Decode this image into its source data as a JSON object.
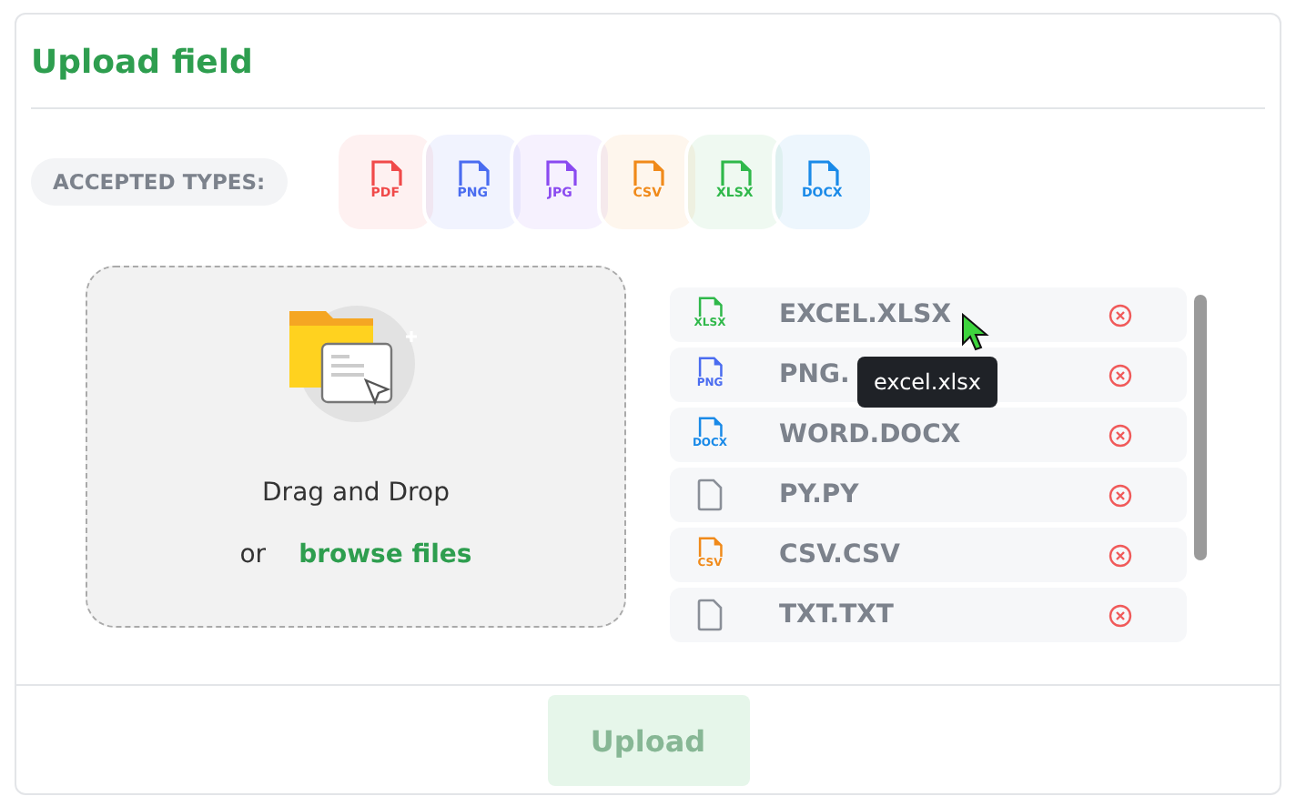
{
  "title": "Upload field",
  "accepted": {
    "label": "ACCEPTED TYPES:",
    "types": [
      {
        "label": "PDF",
        "color": "#f04a4a"
      },
      {
        "label": "PNG",
        "color": "#4a6cf0"
      },
      {
        "label": "JPG",
        "color": "#8a4af0"
      },
      {
        "label": "CSV",
        "color": "#f08a1a"
      },
      {
        "label": "XLSX",
        "color": "#2fb84a"
      },
      {
        "label": "DOCX",
        "color": "#1a8ae8"
      }
    ]
  },
  "dropzone": {
    "heading": "Drag and Drop",
    "or": "or",
    "link": "browse files"
  },
  "files": [
    {
      "name": "EXCEL.XLSX",
      "kind": "typed",
      "icon_label": "XLSX",
      "color": "#2fb84a"
    },
    {
      "name": "PNG.",
      "kind": "typed",
      "icon_label": "PNG",
      "color": "#4a6cf0"
    },
    {
      "name": "WORD.DOCX",
      "kind": "typed",
      "icon_label": "DOCX",
      "color": "#1a8ae8"
    },
    {
      "name": "PY.PY",
      "kind": "plain"
    },
    {
      "name": "CSV.CSV",
      "kind": "typed",
      "icon_label": "CSV",
      "color": "#f08a1a"
    },
    {
      "name": "TXT.TXT",
      "kind": "plain"
    }
  ],
  "tooltip": "excel.xlsx",
  "upload_button": {
    "label": "Upload",
    "disabled": true
  }
}
